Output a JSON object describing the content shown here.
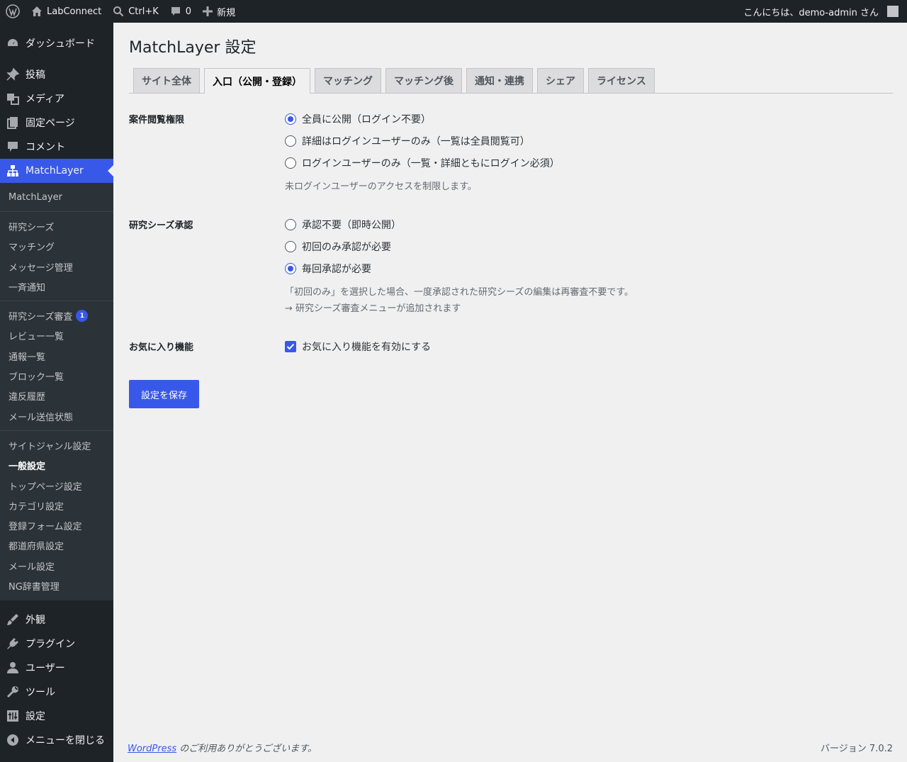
{
  "adminbar": {
    "site_name": "LabConnect",
    "search_shortcut": "Ctrl+K",
    "comments_count": "0",
    "new_label": "新規",
    "greeting": "こんにちは、demo-admin さん"
  },
  "sidebar": {
    "top_items": [
      {
        "label": "ダッシュボード",
        "icon": "dashboard-icon"
      },
      {
        "label": "投稿",
        "icon": "pin-icon"
      },
      {
        "label": "メディア",
        "icon": "media-icon"
      },
      {
        "label": "固定ページ",
        "icon": "page-icon"
      },
      {
        "label": "コメント",
        "icon": "comment-icon"
      },
      {
        "label": "MatchLayer",
        "icon": "sitemap-icon"
      }
    ],
    "sub_items": [
      "MatchLayer",
      "研究シーズ",
      "マッチング",
      "メッセージ管理",
      "一斉通知",
      "研究シーズ審査",
      "レビュー一覧",
      "通報一覧",
      "ブロック一覧",
      "違反履歴",
      "メール送信状態",
      "サイトジャンル設定",
      "一般設定",
      "トップページ設定",
      "カテゴリ設定",
      "登録フォーム設定",
      "都道府県設定",
      "メール設定",
      "NG辞書管理"
    ],
    "review_badge": "1",
    "bottom_items": [
      {
        "label": "外観",
        "icon": "brush-icon"
      },
      {
        "label": "プラグイン",
        "icon": "plugin-icon"
      },
      {
        "label": "ユーザー",
        "icon": "user-icon"
      },
      {
        "label": "ツール",
        "icon": "wrench-icon"
      },
      {
        "label": "設定",
        "icon": "settings-icon"
      },
      {
        "label": "メニューを閉じる",
        "icon": "collapse-icon"
      }
    ]
  },
  "main": {
    "title": "MatchLayer 設定",
    "tabs": [
      "サイト全体",
      "入口（公開・登録）",
      "マッチング",
      "マッチング後",
      "通知・連携",
      "シェア",
      "ライセンス"
    ],
    "active_tab": 1,
    "sections": {
      "access": {
        "label": "案件閲覧権限",
        "options": [
          "全員に公開（ログイン不要）",
          "詳細はログインユーザーのみ（一覧は全員閲覧可）",
          "ログインユーザーのみ（一覧・詳細ともにログイン必須）"
        ],
        "selected": 0,
        "description": "未ログインユーザーのアクセスを制限します。"
      },
      "approval": {
        "label": "研究シーズ承認",
        "options": [
          "承認不要（即時公開）",
          "初回のみ承認が必要",
          "毎回承認が必要"
        ],
        "selected": 2,
        "description1": "「初回のみ」を選択した場合、一度承認された研究シーズの編集は再審査不要です。",
        "description2": "→ 研究シーズ審査メニューが追加されます"
      },
      "favorites": {
        "label": "お気に入り機能",
        "checkbox_label": "お気に入り機能を有効にする",
        "checked": true
      }
    },
    "save_label": "設定を保存"
  },
  "footer": {
    "link_text": "WordPress",
    "thanks_text": " のご利用ありがとうございます。",
    "version": "バージョン 7.0.2"
  }
}
